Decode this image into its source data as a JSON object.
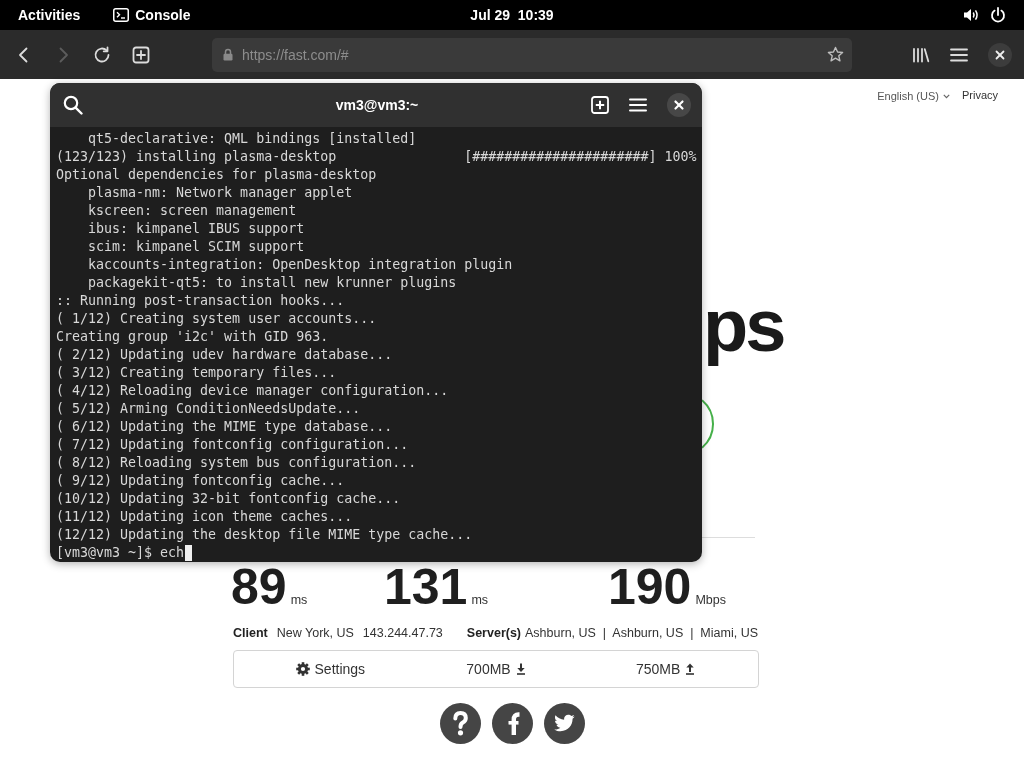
{
  "top_bar": {
    "activities": "Activities",
    "app_menu": "Console",
    "clock": "Jul 29  10:39"
  },
  "browser": {
    "nav_buttons": [
      {
        "kind": "back",
        "disabled": false
      },
      {
        "kind": "forward",
        "disabled": true
      },
      {
        "kind": "reload",
        "disabled": false
      },
      {
        "kind": "new-tab",
        "disabled": false
      }
    ],
    "address_bar": {
      "url": "https://fast.com/#"
    }
  },
  "page": {
    "language": "English (US)",
    "privacy": "Privacy",
    "speed_fragment": "ps",
    "stats": [
      {
        "value": "89",
        "unit": "ms"
      },
      {
        "value": "131",
        "unit": "ms"
      },
      {
        "value": "190",
        "unit": "Mbps"
      }
    ],
    "client": {
      "label": "Client",
      "location": "New York, US",
      "ip": "143.244.47.73"
    },
    "servers": {
      "label": "Server(s)",
      "locations": "Ashburn, US  |  Ashburn, US  |  Miami, US"
    },
    "settings_bar": {
      "settings": "Settings",
      "download": "700MB",
      "upload": "750MB"
    }
  },
  "terminal": {
    "title": "vm3@vm3:~",
    "lines": [
      "    qt5-declarative: QML bindings [installed]",
      "(123/123) installing plasma-desktop                [######################] 100%",
      "Optional dependencies for plasma-desktop",
      "    plasma-nm: Network manager applet",
      "    kscreen: screen management",
      "    ibus: kimpanel IBUS support",
      "    scim: kimpanel SCIM support",
      "    kaccounts-integration: OpenDesktop integration plugin",
      "    packagekit-qt5: to install new krunner plugins",
      ":: Running post-transaction hooks...",
      "( 1/12) Creating system user accounts...",
      "Creating group 'i2c' with GID 963.",
      "( 2/12) Updating udev hardware database...",
      "( 3/12) Creating temporary files...",
      "( 4/12) Reloading device manager configuration...",
      "( 5/12) Arming ConditionNeedsUpdate...",
      "( 6/12) Updating the MIME type database...",
      "( 7/12) Updating fontconfig configuration...",
      "( 8/12) Reloading system bus configuration...",
      "( 9/12) Updating fontconfig cache...",
      "(10/12) Updating 32-bit fontconfig cache...",
      "(11/12) Updating icon theme caches...",
      "(12/12) Updating the desktop file MIME type cache..."
    ],
    "prompt": "[vm3@vm3 ~]$ ech"
  }
}
